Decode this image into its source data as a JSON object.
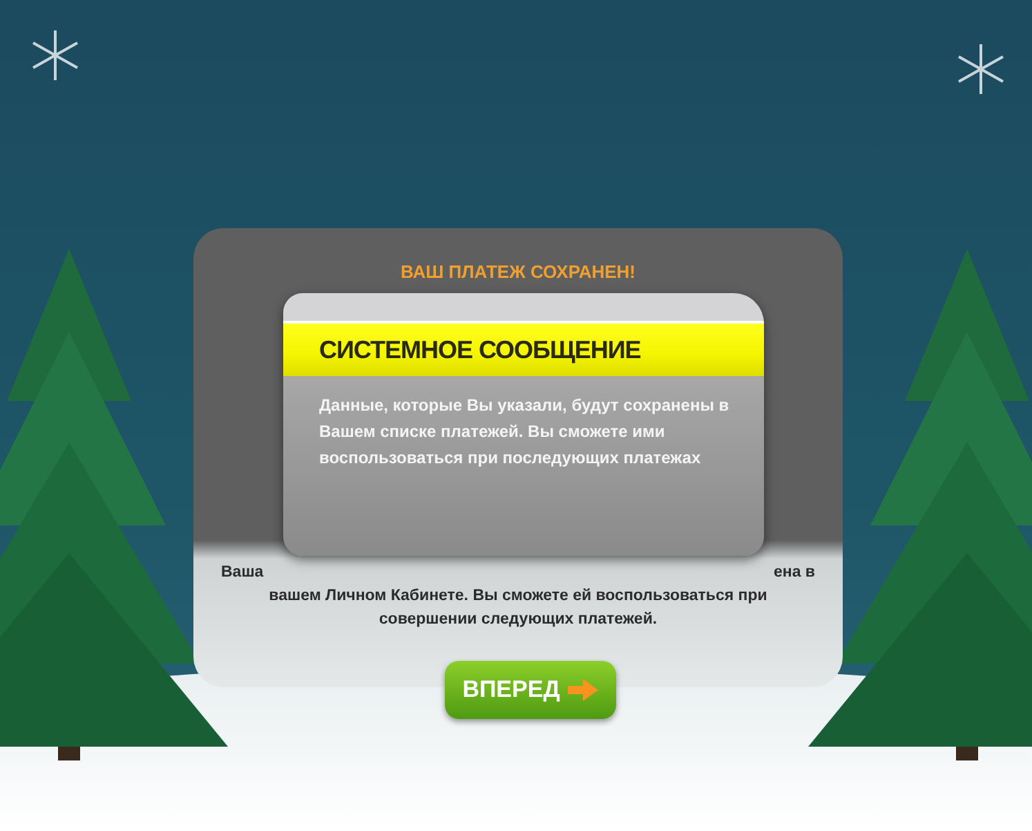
{
  "panel": {
    "title": "ВАШ ПЛАТЕЖ СОХРАНЕН!",
    "message_fragments": [
      "Ваша",
      "ена в"
    ],
    "message": "вашем Личном Кабинете. Вы сможете ей воспользоваться при совершении следующих платежей.",
    "button": "ВПЕРЕД"
  },
  "dialog": {
    "title": "СИСТЕМНОЕ СООБЩЕНИЕ",
    "message": "Данные, которые Вы указали, будут сохранены в Вашем списке платежей. Вы сможете ими воспользоваться при последующих платежах"
  }
}
